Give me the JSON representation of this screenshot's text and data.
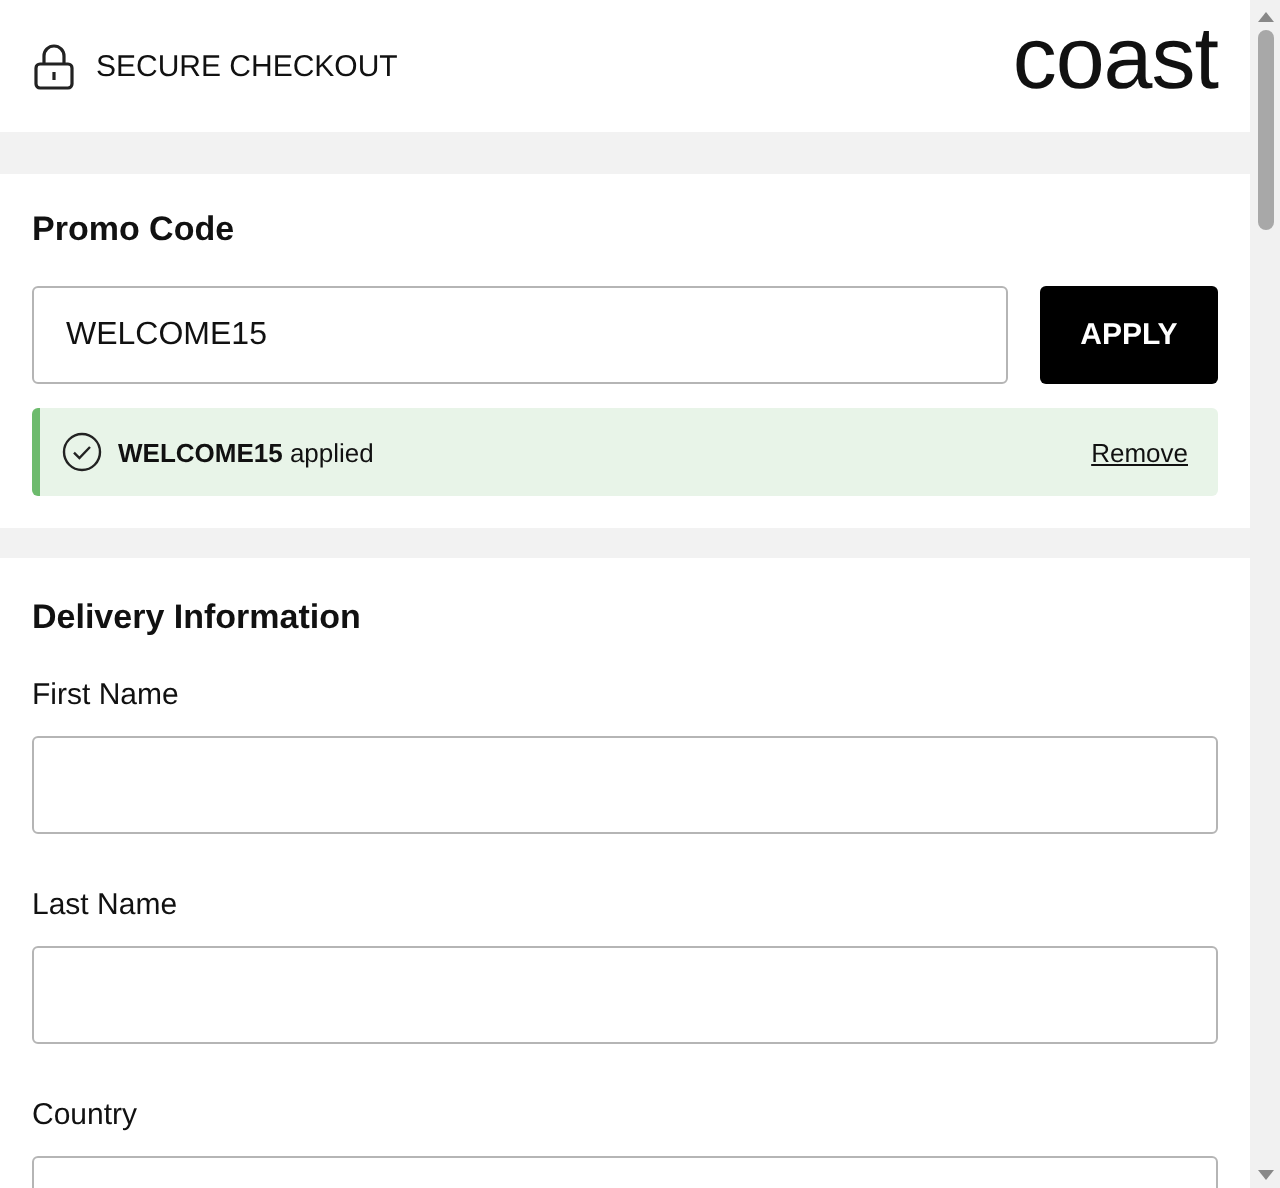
{
  "header": {
    "secure_label": "SECURE CHECKOUT",
    "logo": "coast"
  },
  "promo": {
    "title": "Promo Code",
    "value": "WELCOME15",
    "button": "APPLY",
    "notice": {
      "text": "**WELCOME15** applied",
      "action": "Remove"
    }
  },
  "delivery": {
    "title": "Delivery Information",
    "fields": [
      {
        "label": "First Name"
      },
      {
        "label": "Last Name"
      },
      {
        "label": "Country"
      }
    ]
  }
}
